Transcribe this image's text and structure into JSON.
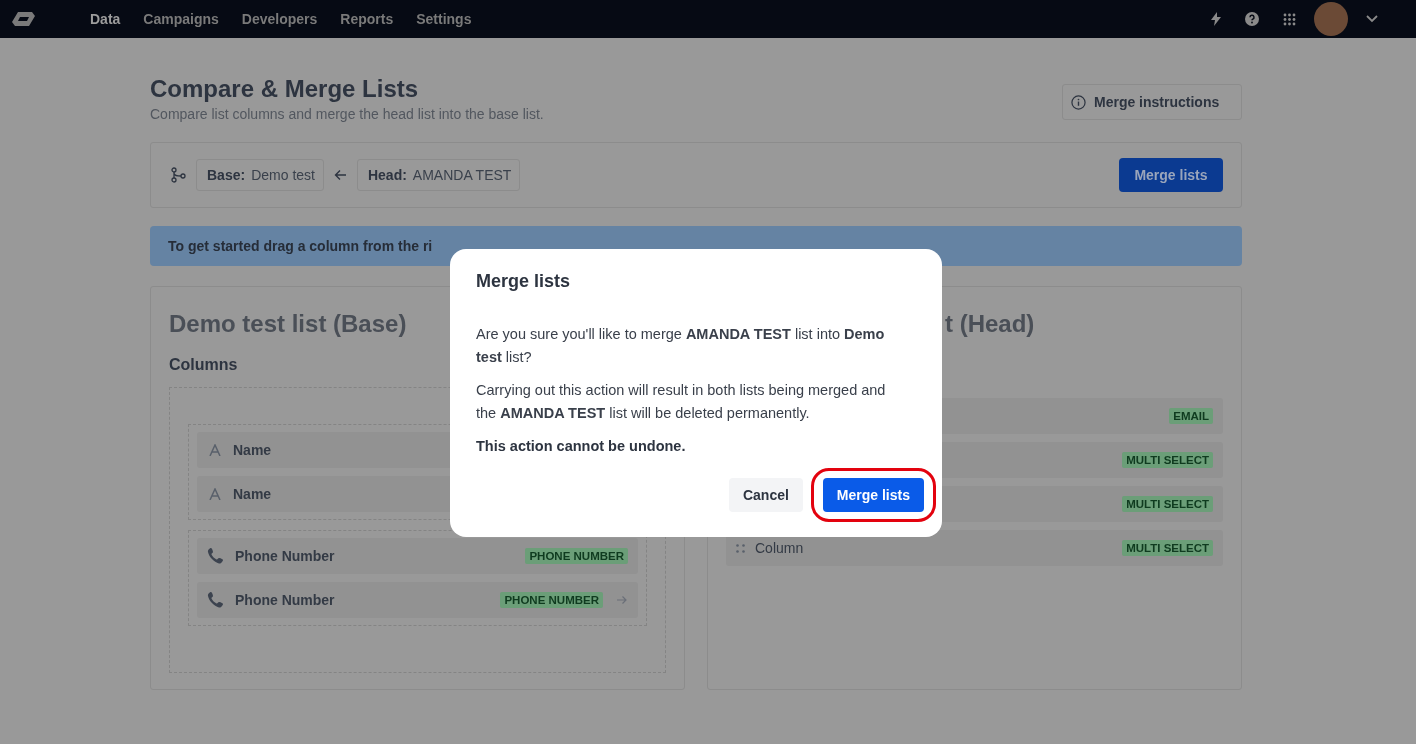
{
  "nav": {
    "items": [
      {
        "label": "Data",
        "selected": true
      },
      {
        "label": "Campaigns",
        "selected": false
      },
      {
        "label": "Developers",
        "selected": false
      },
      {
        "label": "Reports",
        "selected": false
      },
      {
        "label": "Settings",
        "selected": false
      }
    ]
  },
  "page": {
    "title": "Compare & Merge Lists",
    "subtitle": "Compare list columns and merge the head list into the base list.",
    "instructions_button": "Merge instructions"
  },
  "toolbar": {
    "base_label": "Base:",
    "base_value": "Demo test",
    "head_label": "Head:",
    "head_value": "AMANDA TEST",
    "merge_button": "Merge lists"
  },
  "banner": {
    "text": "To get started drag a column from the ri"
  },
  "base_panel": {
    "title": "Demo test list (Base)",
    "columns_heading": "Columns",
    "groups": [
      [
        {
          "kind": "text",
          "label": "Name",
          "show_arrow": false
        },
        {
          "kind": "text",
          "label": "Name",
          "show_arrow": false
        }
      ],
      [
        {
          "kind": "phone",
          "label": "Phone Number",
          "badge": "PHONE NUMBER",
          "show_arrow": false
        },
        {
          "kind": "phone",
          "label": "Phone Number",
          "badge": "PHONE NUMBER",
          "show_arrow": true
        }
      ]
    ]
  },
  "head_panel": {
    "title": "t (Head)",
    "rows": [
      {
        "kind": "none",
        "badge": "EMAIL"
      },
      {
        "kind": "none",
        "badge": "MULTI SELECT"
      },
      {
        "kind": "none",
        "badge": "MULTI SELECT"
      },
      {
        "kind": "drag",
        "label": "Column",
        "badge": "MULTI SELECT"
      }
    ]
  },
  "dialog": {
    "title": "Merge lists",
    "paragraphs": [
      "Are you sure you'll like to merge **AMANDA TEST** list into **Demo test** list?",
      "Carrying out this action will result in both lists being merged and the **AMANDA TEST** list will be deleted permanently."
    ],
    "warning": "This action cannot be undone.",
    "cancel": "Cancel",
    "confirm": "Merge lists",
    "confirm_highlighted": true
  }
}
